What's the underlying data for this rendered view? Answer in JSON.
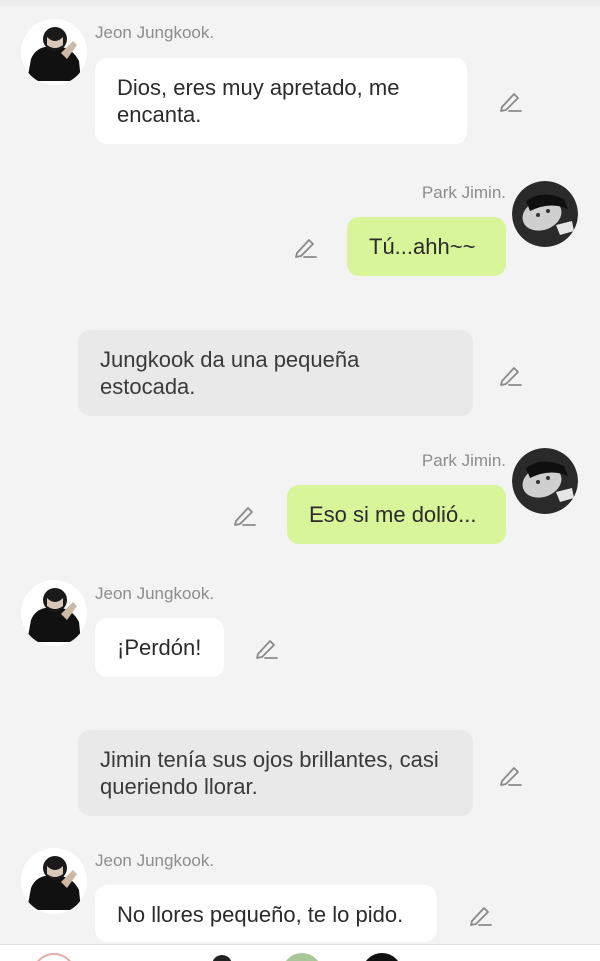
{
  "chat": {
    "messages": [
      {
        "type": "char",
        "side": "left",
        "name": "Jeon Jungkook.",
        "text": "Dios, eres muy apretado, me encanta."
      },
      {
        "type": "char",
        "side": "right",
        "name": "Park Jimin.",
        "text": "Tú...ahh~~"
      },
      {
        "type": "narration",
        "text": "Jungkook da una pequeña estocada."
      },
      {
        "type": "char",
        "side": "right",
        "name": "Park Jimin.",
        "text": "Eso si me dolió..."
      },
      {
        "type": "char",
        "side": "left",
        "name": "Jeon Jungkook.",
        "text": "¡Perdón!"
      },
      {
        "type": "narration",
        "text": "Jimin tenía sus ojos brillantes, casi queriendo llorar."
      },
      {
        "type": "char",
        "side": "left",
        "name": "Jeon Jungkook.",
        "text": "No llores pequeño, te lo pido."
      }
    ]
  },
  "icons": {
    "edit": "pencil-edit-icon",
    "avatar_jungkook": "avatar-jungkook",
    "avatar_jimin": "avatar-jimin"
  },
  "colors": {
    "background": "#f3f3f3",
    "bubble_left": "#ffffff",
    "bubble_right": "#d8f59a",
    "narration": "#e9e9e9",
    "name": "#8d8d8d"
  }
}
